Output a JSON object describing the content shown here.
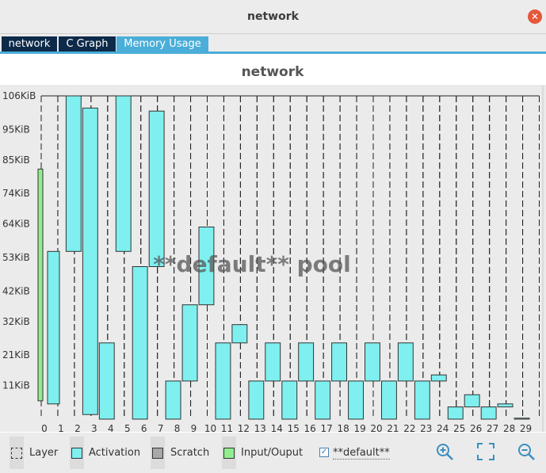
{
  "window": {
    "title": "network"
  },
  "tabs": [
    {
      "label": "network",
      "active": false
    },
    {
      "label": "C Graph",
      "active": false
    },
    {
      "label": "Memory Usage",
      "active": true
    }
  ],
  "chart_data": {
    "type": "bar",
    "title": "network",
    "watermark": "**default** pool",
    "x": [
      0,
      1,
      2,
      3,
      4,
      5,
      6,
      7,
      8,
      9,
      10,
      11,
      12,
      13,
      14,
      15,
      16,
      17,
      18,
      19,
      20,
      21,
      22,
      23,
      24,
      25,
      26,
      27,
      28,
      29
    ],
    "ytick_labels": [
      "11KiB",
      "21KiB",
      "32KiB",
      "42KiB",
      "53KiB",
      "64KiB",
      "74KiB",
      "85KiB",
      "95KiB",
      "106KiB"
    ],
    "ytick_values": [
      11,
      21,
      32,
      42,
      53,
      64,
      74,
      85,
      95,
      106
    ],
    "ylim": [
      0,
      106
    ],
    "blocks": [
      {
        "kind": "io",
        "start": 0,
        "end": 0,
        "low": 6,
        "high": 82
      },
      {
        "kind": "act",
        "start": 0,
        "end": 1,
        "low": 5,
        "high": 55
      },
      {
        "kind": "act",
        "start": 1,
        "end": 2,
        "low": 55,
        "high": 106
      },
      {
        "kind": "act",
        "start": 2,
        "end": 3,
        "low": 1.5,
        "high": 102
      },
      {
        "kind": "act",
        "start": 3,
        "end": 4,
        "low": 0,
        "high": 25
      },
      {
        "kind": "act",
        "start": 4,
        "end": 5,
        "low": 55,
        "high": 106
      },
      {
        "kind": "act",
        "start": 5,
        "end": 6,
        "low": 0,
        "high": 50
      },
      {
        "kind": "act",
        "start": 6,
        "end": 7,
        "low": 50,
        "high": 101
      },
      {
        "kind": "act",
        "start": 7,
        "end": 8,
        "low": 0,
        "high": 12.5
      },
      {
        "kind": "act",
        "start": 8,
        "end": 9,
        "low": 12.5,
        "high": 37.5
      },
      {
        "kind": "act",
        "start": 9,
        "end": 10,
        "low": 37.5,
        "high": 63
      },
      {
        "kind": "act",
        "start": 10,
        "end": 11,
        "low": 0,
        "high": 25
      },
      {
        "kind": "act",
        "start": 11,
        "end": 12,
        "low": 25,
        "high": 31
      },
      {
        "kind": "act",
        "start": 12,
        "end": 13,
        "low": 0,
        "high": 12.5
      },
      {
        "kind": "act",
        "start": 13,
        "end": 14,
        "low": 12.5,
        "high": 25
      },
      {
        "kind": "act",
        "start": 14,
        "end": 15,
        "low": 0,
        "high": 12.5
      },
      {
        "kind": "act",
        "start": 15,
        "end": 16,
        "low": 12.5,
        "high": 25
      },
      {
        "kind": "act",
        "start": 16,
        "end": 17,
        "low": 0,
        "high": 12.5
      },
      {
        "kind": "act",
        "start": 17,
        "end": 18,
        "low": 12.5,
        "high": 25
      },
      {
        "kind": "act",
        "start": 18,
        "end": 19,
        "low": 0,
        "high": 12.5
      },
      {
        "kind": "act",
        "start": 19,
        "end": 20,
        "low": 12.5,
        "high": 25
      },
      {
        "kind": "act",
        "start": 20,
        "end": 21,
        "low": 0,
        "high": 12.5
      },
      {
        "kind": "act",
        "start": 21,
        "end": 22,
        "low": 12.5,
        "high": 25
      },
      {
        "kind": "act",
        "start": 22,
        "end": 23,
        "low": 0,
        "high": 12.5
      },
      {
        "kind": "act",
        "start": 23,
        "end": 24,
        "low": 12.5,
        "high": 14.5
      },
      {
        "kind": "act",
        "start": 24,
        "end": 25,
        "low": 0,
        "high": 4
      },
      {
        "kind": "act",
        "start": 25,
        "end": 26,
        "low": 4,
        "high": 8
      },
      {
        "kind": "act",
        "start": 26,
        "end": 27,
        "low": 0,
        "high": 4
      },
      {
        "kind": "act",
        "start": 27,
        "end": 28,
        "low": 4,
        "high": 5
      },
      {
        "kind": "act",
        "start": 28,
        "end": 29,
        "low": 0,
        "high": 0.3
      }
    ]
  },
  "legend": [
    {
      "label": "Layer",
      "style": "dashed"
    },
    {
      "label": "Activation",
      "color": "#7fefef"
    },
    {
      "label": "Scratch",
      "color": "#a8a8a8"
    },
    {
      "label": "Input/Ouput",
      "color": "#90ee90"
    }
  ],
  "pool_filter": {
    "label": "**default**",
    "checked": true
  },
  "toolbar": {
    "icons": [
      "zoom-in-icon",
      "fit-to-screen-icon",
      "zoom-out-icon"
    ]
  },
  "colors": {
    "activation": "#7fefef",
    "io": "#90ee90",
    "accent": "#4aaed9",
    "tab_dark": "#0d2a4a"
  }
}
